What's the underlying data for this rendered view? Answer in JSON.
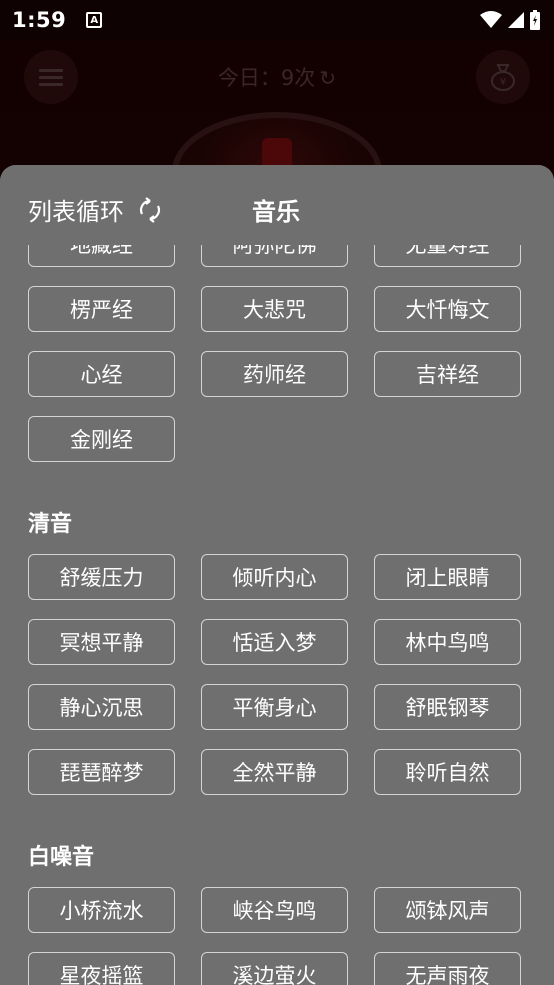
{
  "status_bar": {
    "time": "1:59",
    "notification_icon": "A"
  },
  "background": {
    "today_label": "今日：9次",
    "refresh_icon": "↻"
  },
  "sheet": {
    "loop_mode": "列表循环",
    "title": "音乐"
  },
  "sections": [
    {
      "title": "",
      "items": [
        "地藏经",
        "阿弥陀佛",
        "无量寿经",
        "楞严经",
        "大悲咒",
        "大忏悔文",
        "心经",
        "药师经",
        "吉祥经",
        "金刚经"
      ]
    },
    {
      "title": "清音",
      "items": [
        "舒缓压力",
        "倾听内心",
        "闭上眼睛",
        "冥想平静",
        "恬适入梦",
        "林中鸟鸣",
        "静心沉思",
        "平衡身心",
        "舒眠钢琴",
        "琵琶醉梦",
        "全然平静",
        "聆听自然"
      ]
    },
    {
      "title": "白噪音",
      "items": [
        "小桥流水",
        "峡谷鸟鸣",
        "颂钵风声",
        "星夜摇篮",
        "溪边萤火",
        "无声雨夜"
      ]
    }
  ]
}
